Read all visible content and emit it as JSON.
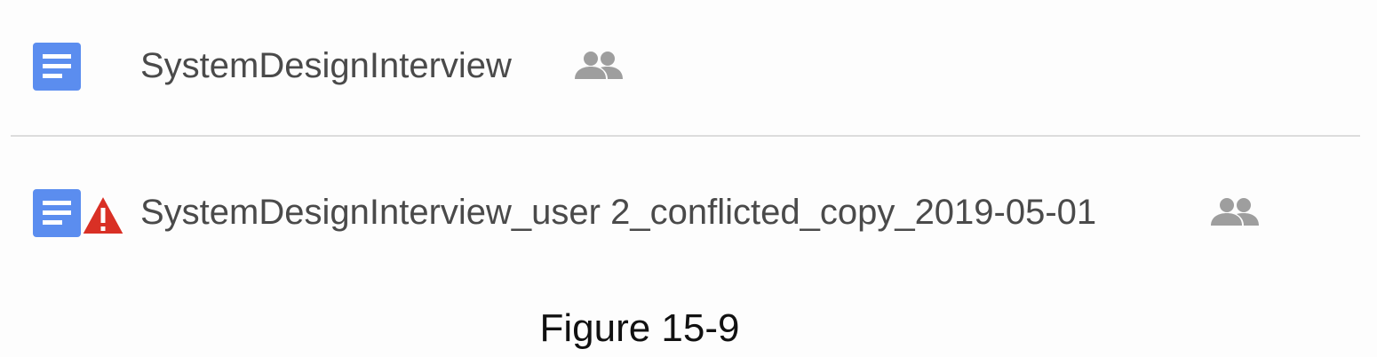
{
  "files": [
    {
      "name": "SystemDesignInterview",
      "icon": "google-docs-icon",
      "shared_icon": "people-icon",
      "conflict": false
    },
    {
      "name": "SystemDesignInterview_user 2_conflicted_copy_2019-05-01",
      "icon": "google-docs-icon",
      "warning_icon": "warning-triangle-icon",
      "shared_icon": "people-icon",
      "conflict": true
    }
  ],
  "caption": "Figure 15-9",
  "colors": {
    "doc_blue": "#5B8DEF",
    "warning_red": "#D93025",
    "shared_gray": "#9E9E9E",
    "text": "#4A4A4A",
    "divider": "#DCDCDC"
  }
}
